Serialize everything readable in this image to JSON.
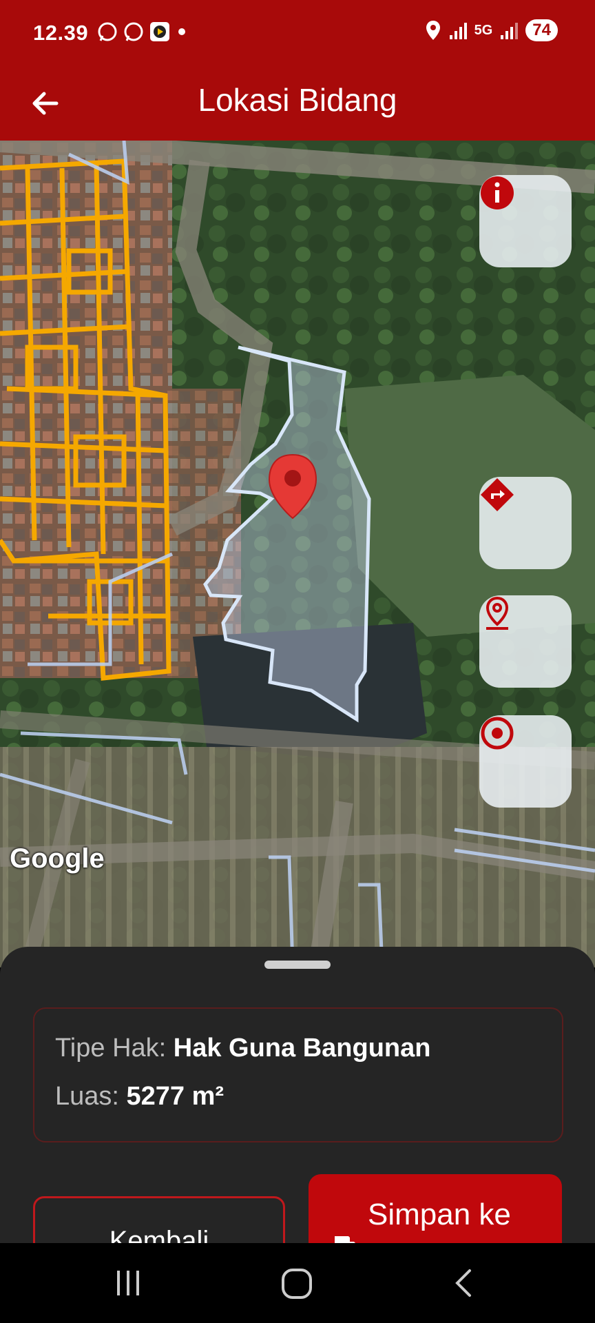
{
  "status_bar": {
    "time": "12.39",
    "network": "5G",
    "battery": "74"
  },
  "app_bar": {
    "title": "Lokasi Bidang"
  },
  "map": {
    "attribution": "Google",
    "marker_color": "#e53935",
    "parcel_outline_color": "#c9dcf2",
    "neighbor_parcel_color": "#f5a800"
  },
  "parcel": {
    "rights_type_label": "Tipe Hak:",
    "rights_type_value": "Hak Guna Bangunan",
    "area_label": "Luas:",
    "area_value": "5277 m²"
  },
  "actions": {
    "back_label": "Kembali",
    "save_label": "Simpan ke"
  },
  "icons": [
    "back-arrow-icon",
    "info-icon",
    "directions-icon",
    "location-pin-icon",
    "target-icon",
    "save-file-icon"
  ],
  "colors": {
    "brand": "#a80a0a",
    "sheet_bg": "#252525",
    "button_red": "#c0080c"
  }
}
